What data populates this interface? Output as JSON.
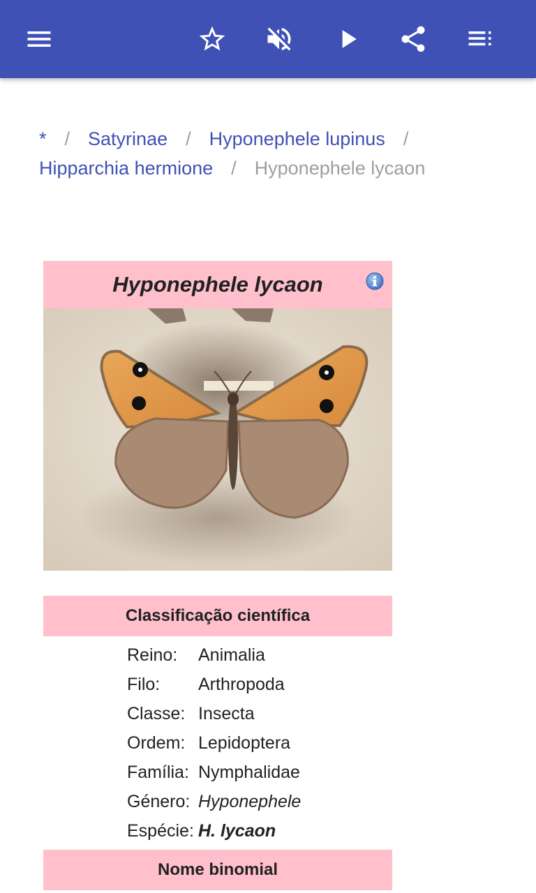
{
  "toolbar": {
    "icons": [
      "menu-icon",
      "star-outline-icon",
      "volume-off-icon",
      "play-icon",
      "share-icon",
      "playlist-icon"
    ]
  },
  "breadcrumb": {
    "items": [
      "*",
      "Satyrinae",
      "Hyponephele lupinus",
      "Hipparchia hermione"
    ],
    "separator": "/",
    "current": "Hyponephele lycaon"
  },
  "infobox": {
    "title": "Hyponephele lycaon",
    "classification_header": "Classificação científica",
    "ranks": [
      {
        "label": "Reino:",
        "value": "Animalia"
      },
      {
        "label": "Filo:",
        "value": "Arthropoda"
      },
      {
        "label": "Classe:",
        "value": "Insecta"
      },
      {
        "label": "Ordem:",
        "value": "Lepidoptera"
      },
      {
        "label": "Família:",
        "value": "Nymphalidae"
      },
      {
        "label": "Género:",
        "value": "Hyponephele"
      },
      {
        "label": "Espécie:",
        "value": "H. lycaon"
      }
    ],
    "binomial_header": "Nome binomial"
  },
  "colors": {
    "appbar": "#3f51b5",
    "infobox_header": "#ffc0cb",
    "link": "#3f51b5"
  }
}
